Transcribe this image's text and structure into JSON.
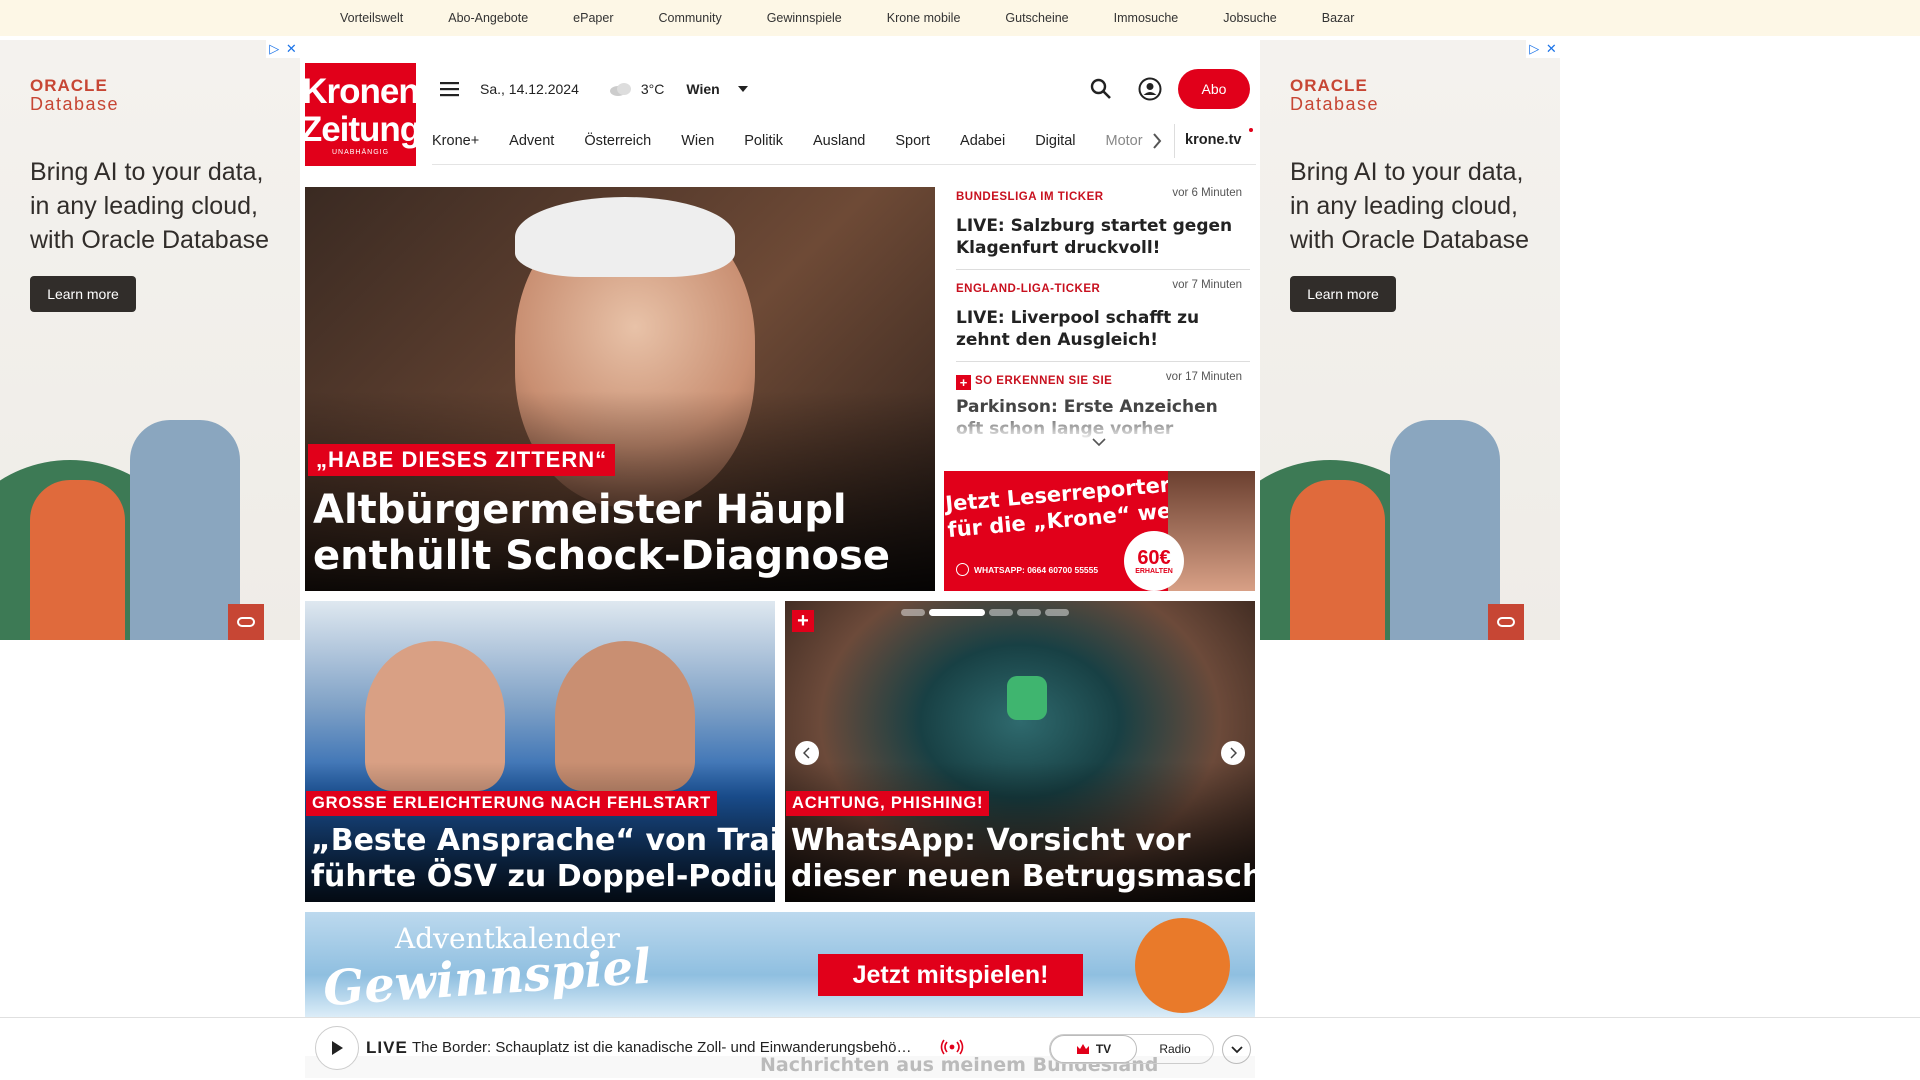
{
  "topbar": {
    "links": [
      "Vorteilswelt",
      "Abo-Angebote",
      "ePaper",
      "Community",
      "Gewinnspiele",
      "Krone mobile",
      "Gutscheine",
      "Immosuche",
      "Jobsuche",
      "Bazar"
    ]
  },
  "ad": {
    "brand_top": "ORACLE",
    "brand_bottom": "Database",
    "headline": "Bring AI to your data, in any leading cloud, with Oracle Database",
    "button": "Learn more",
    "adchoice_i": "▷",
    "adchoice_x": "✕"
  },
  "logo": {
    "line1": "Kronen",
    "line2": "Zeitung",
    "tag": "UNABHÄNGIG"
  },
  "header": {
    "date": "Sa., 14.12.2024",
    "temperature": "3°C",
    "city": "Wien",
    "abo": "Abo"
  },
  "nav": {
    "items": [
      "Krone+",
      "Advent",
      "Österreich",
      "Wien",
      "Politik",
      "Ausland",
      "Sport",
      "Adabei",
      "Digital",
      "Motor"
    ],
    "tv": "krone.tv"
  },
  "hero": {
    "kicker": "„HABE DIESES ZITTERN“",
    "title_line1": "Altbürgermeister Häupl",
    "title_line2": "enthüllt Schock-Diagnose"
  },
  "ticker": [
    {
      "kicker": "BUNDESLIGA IM TICKER",
      "time": "vor 6 Minuten",
      "title": "LIVE: Salzburg startet gegen Klagenfurt druckvoll!"
    },
    {
      "kicker": "ENGLAND-LIGA-TICKER",
      "time": "vor 7 Minuten",
      "title": "LIVE: Liverpool schafft zu zehnt den Ausgleich!"
    },
    {
      "kicker": "SO ERKENNEN SIE SIE",
      "time": "vor 17 Minuten",
      "title": "Parkinson: Erste Anzeichen oft schon lange vorher"
    }
  ],
  "reporter": {
    "line1": "Jetzt Leserreporter",
    "line2": "für die „Krone“ werden",
    "whatsapp": "WHATSAPP: 0664 60700 55555",
    "amount": "60€",
    "erhalten": "ERHALTEN"
  },
  "card1": {
    "kicker": "GROSSE ERLEICHTERUNG NACH FEHLSTART",
    "title_line1": "„Beste Ansprache“ von Trainer",
    "title_line2": "führte ÖSV zu Doppel-Podium"
  },
  "card2": {
    "kicker": "ACHTUNG, PHISHING!",
    "title_line1": "WhatsApp: Vorsicht vor",
    "title_line2": "dieser neuen Betrugsmasche!"
  },
  "advent": {
    "line1": "Adventkalender",
    "line2": "Gewinnspiel",
    "cta": "Jetzt mitspielen!"
  },
  "live": {
    "label": "LIVE",
    "text": "The Border: Schauplatz ist die kanadische Zoll- und Einwanderungsbehö…",
    "tv": "TV",
    "radio": "Radio",
    "below": "Nachrichten aus meinem Bundesland"
  },
  "colors": {
    "brand_red": "#e1001a",
    "oracle_red": "#c74634",
    "topbar_bg": "#fdf7e6"
  }
}
